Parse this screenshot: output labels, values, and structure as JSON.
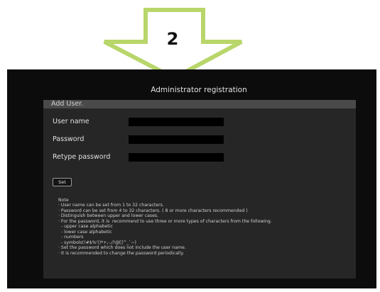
{
  "step": {
    "number": "2",
    "arrow_fill": "#ffffff",
    "arrow_stroke": "#b8d66a"
  },
  "screen": {
    "title": "Administrator registration",
    "background": "#0c0c0c"
  },
  "panel": {
    "header": "Add User.",
    "fields": [
      {
        "label": "User name",
        "value": ""
      },
      {
        "label": "Password",
        "value": ""
      },
      {
        "label": "Retype password",
        "value": ""
      }
    ],
    "set_button": "Set"
  },
  "notes": [
    "Note",
    "· User name can be set from 1 to 32 characters.",
    "· Password can be set from 4 to 32 characters. ( 8 or more characters recommended )",
    "· Distinguish between upper and lower cases.",
    "· For the password, it is  recommend to use three or more types of characters from the following.",
    "  - upper case alphabetic",
    "  - lower case alphabetic",
    "  - numbers",
    "  - symbols(!#$%'()*+,-./?@[]^_`~)",
    "· Set the password which does not include the user name.",
    "· It is recommended to change the password periodically."
  ]
}
